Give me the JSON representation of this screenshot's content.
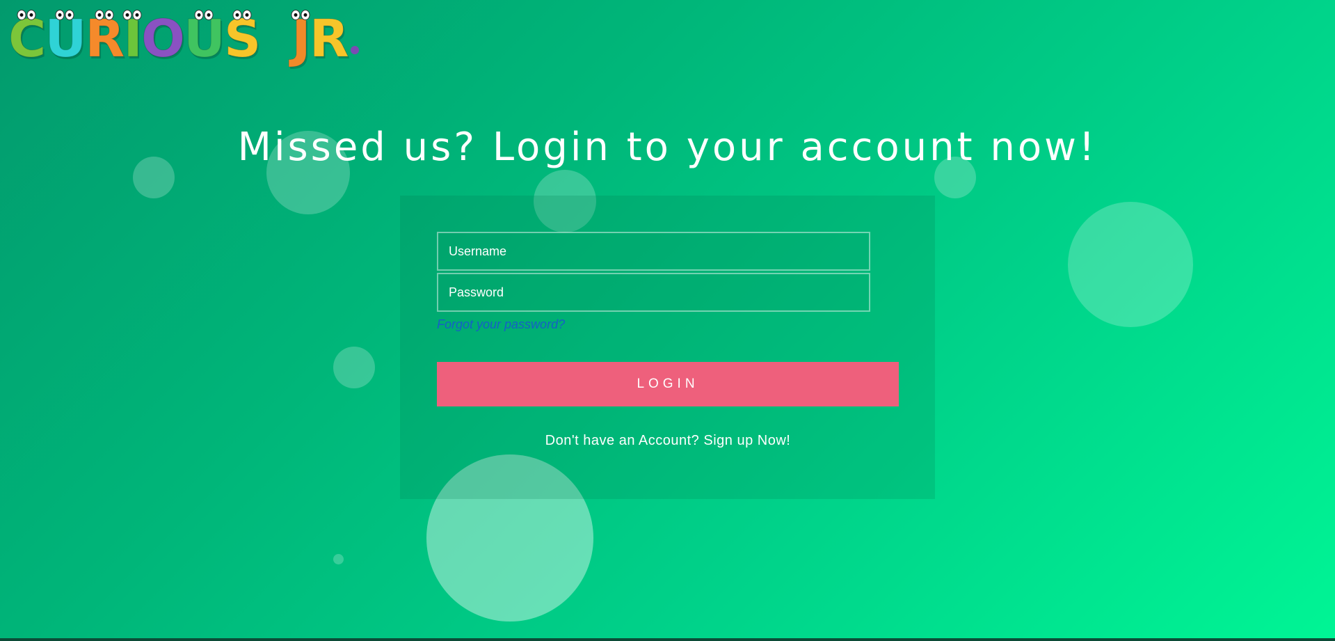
{
  "logo": {
    "letters": [
      {
        "char": "C",
        "color": "#7cc63a"
      },
      {
        "char": "U",
        "color": "#2fd3d6"
      },
      {
        "char": "R",
        "color": "#f58a2b"
      },
      {
        "char": "I",
        "color": "#6cc53b"
      },
      {
        "char": "O",
        "color": "#8a52c2"
      },
      {
        "char": "U",
        "color": "#40c460"
      },
      {
        "char": "S",
        "color": "#f7c52a"
      },
      {
        "char": "J",
        "color": "#f08a2a"
      },
      {
        "char": "R",
        "color": "#f7c52a"
      }
    ],
    "text": "CURIOUS JR."
  },
  "heading": "Missed us? Login to your account now!",
  "form": {
    "username_placeholder": "Username",
    "password_placeholder": "Password",
    "forgot_link": "Forgot your password?",
    "login_label": "LOGIN",
    "signup_text": "Don't have an Account? Sign up Now!"
  },
  "colors": {
    "background_start": "#029a6d",
    "background_end": "#00f595",
    "login_button": "#ee607c",
    "forgot_link": "#1560c6"
  }
}
